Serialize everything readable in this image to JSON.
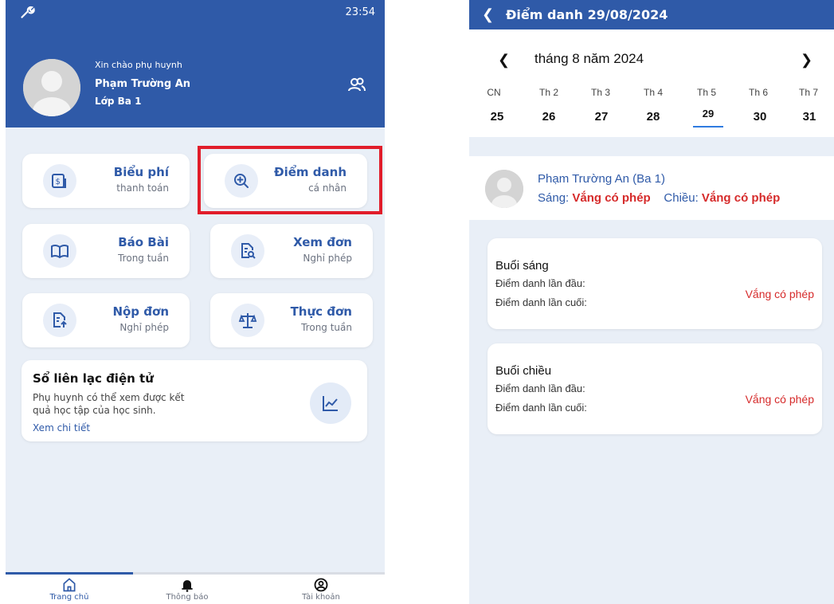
{
  "left": {
    "statusbar": {
      "time": "23:54"
    },
    "header": {
      "greeting": "Xin chào phụ huynh",
      "parent_name": "Phạm Trường An",
      "class_name": "Lớp Ba 1"
    },
    "features": [
      {
        "title": "Biểu phí",
        "subtitle": "thanh toán",
        "icon": "fee-icon"
      },
      {
        "title": "Điểm danh",
        "subtitle": "cá nhân",
        "icon": "zoom-plus-icon"
      },
      {
        "title": "Báo Bài",
        "subtitle": "Trong tuần",
        "icon": "book-icon"
      },
      {
        "title": "Xem đơn",
        "subtitle": "Nghỉ phép",
        "icon": "document-search-icon"
      },
      {
        "title": "Nộp đơn",
        "subtitle": "Nghỉ phép",
        "icon": "document-upload-icon"
      },
      {
        "title": "Thực đơn",
        "subtitle": "Trong tuần",
        "icon": "scale-icon"
      }
    ],
    "contact_book": {
      "title": "Sổ liên lạc điện tử",
      "desc_line1": "Phụ huynh có thể xem được kết",
      "desc_line2": "quả học tập của học sinh.",
      "link": "Xem chi tiết"
    },
    "bottom_nav": [
      {
        "label": "Trang chủ",
        "icon": "home-icon"
      },
      {
        "label": "Thông báo",
        "icon": "bell-icon"
      },
      {
        "label": "Tài khoản",
        "icon": "account-icon"
      }
    ],
    "highlight_color": "#e11d2a"
  },
  "right": {
    "title": "Điểm danh 29/08/2024",
    "month": "tháng 8 năm 2024",
    "weekdays": [
      "CN",
      "Th 2",
      "Th 3",
      "Th 4",
      "Th 5",
      "Th 6",
      "Th 7"
    ],
    "days": [
      "25",
      "26",
      "27",
      "28",
      "29",
      "30",
      "31"
    ],
    "student": {
      "name": "Phạm Trường An (Ba 1)",
      "morning_label": "Sáng:",
      "morning_status": "Vắng có phép",
      "afternoon_label": "Chiều:",
      "afternoon_status": "Vắng có phép"
    },
    "sessions": [
      {
        "title": "Buổi sáng",
        "first": "Điểm danh lần đầu:",
        "last": "Điểm danh lần cuối:",
        "status": "Vắng có phép"
      },
      {
        "title": "Buổi chiều",
        "first": "Điểm danh lần đầu:",
        "last": "Điểm danh lần cuối:",
        "status": "Vắng có phép"
      }
    ]
  },
  "colors": {
    "primary": "#2f5aa8",
    "absent": "#d62b2b",
    "background": "#e9eff7"
  }
}
